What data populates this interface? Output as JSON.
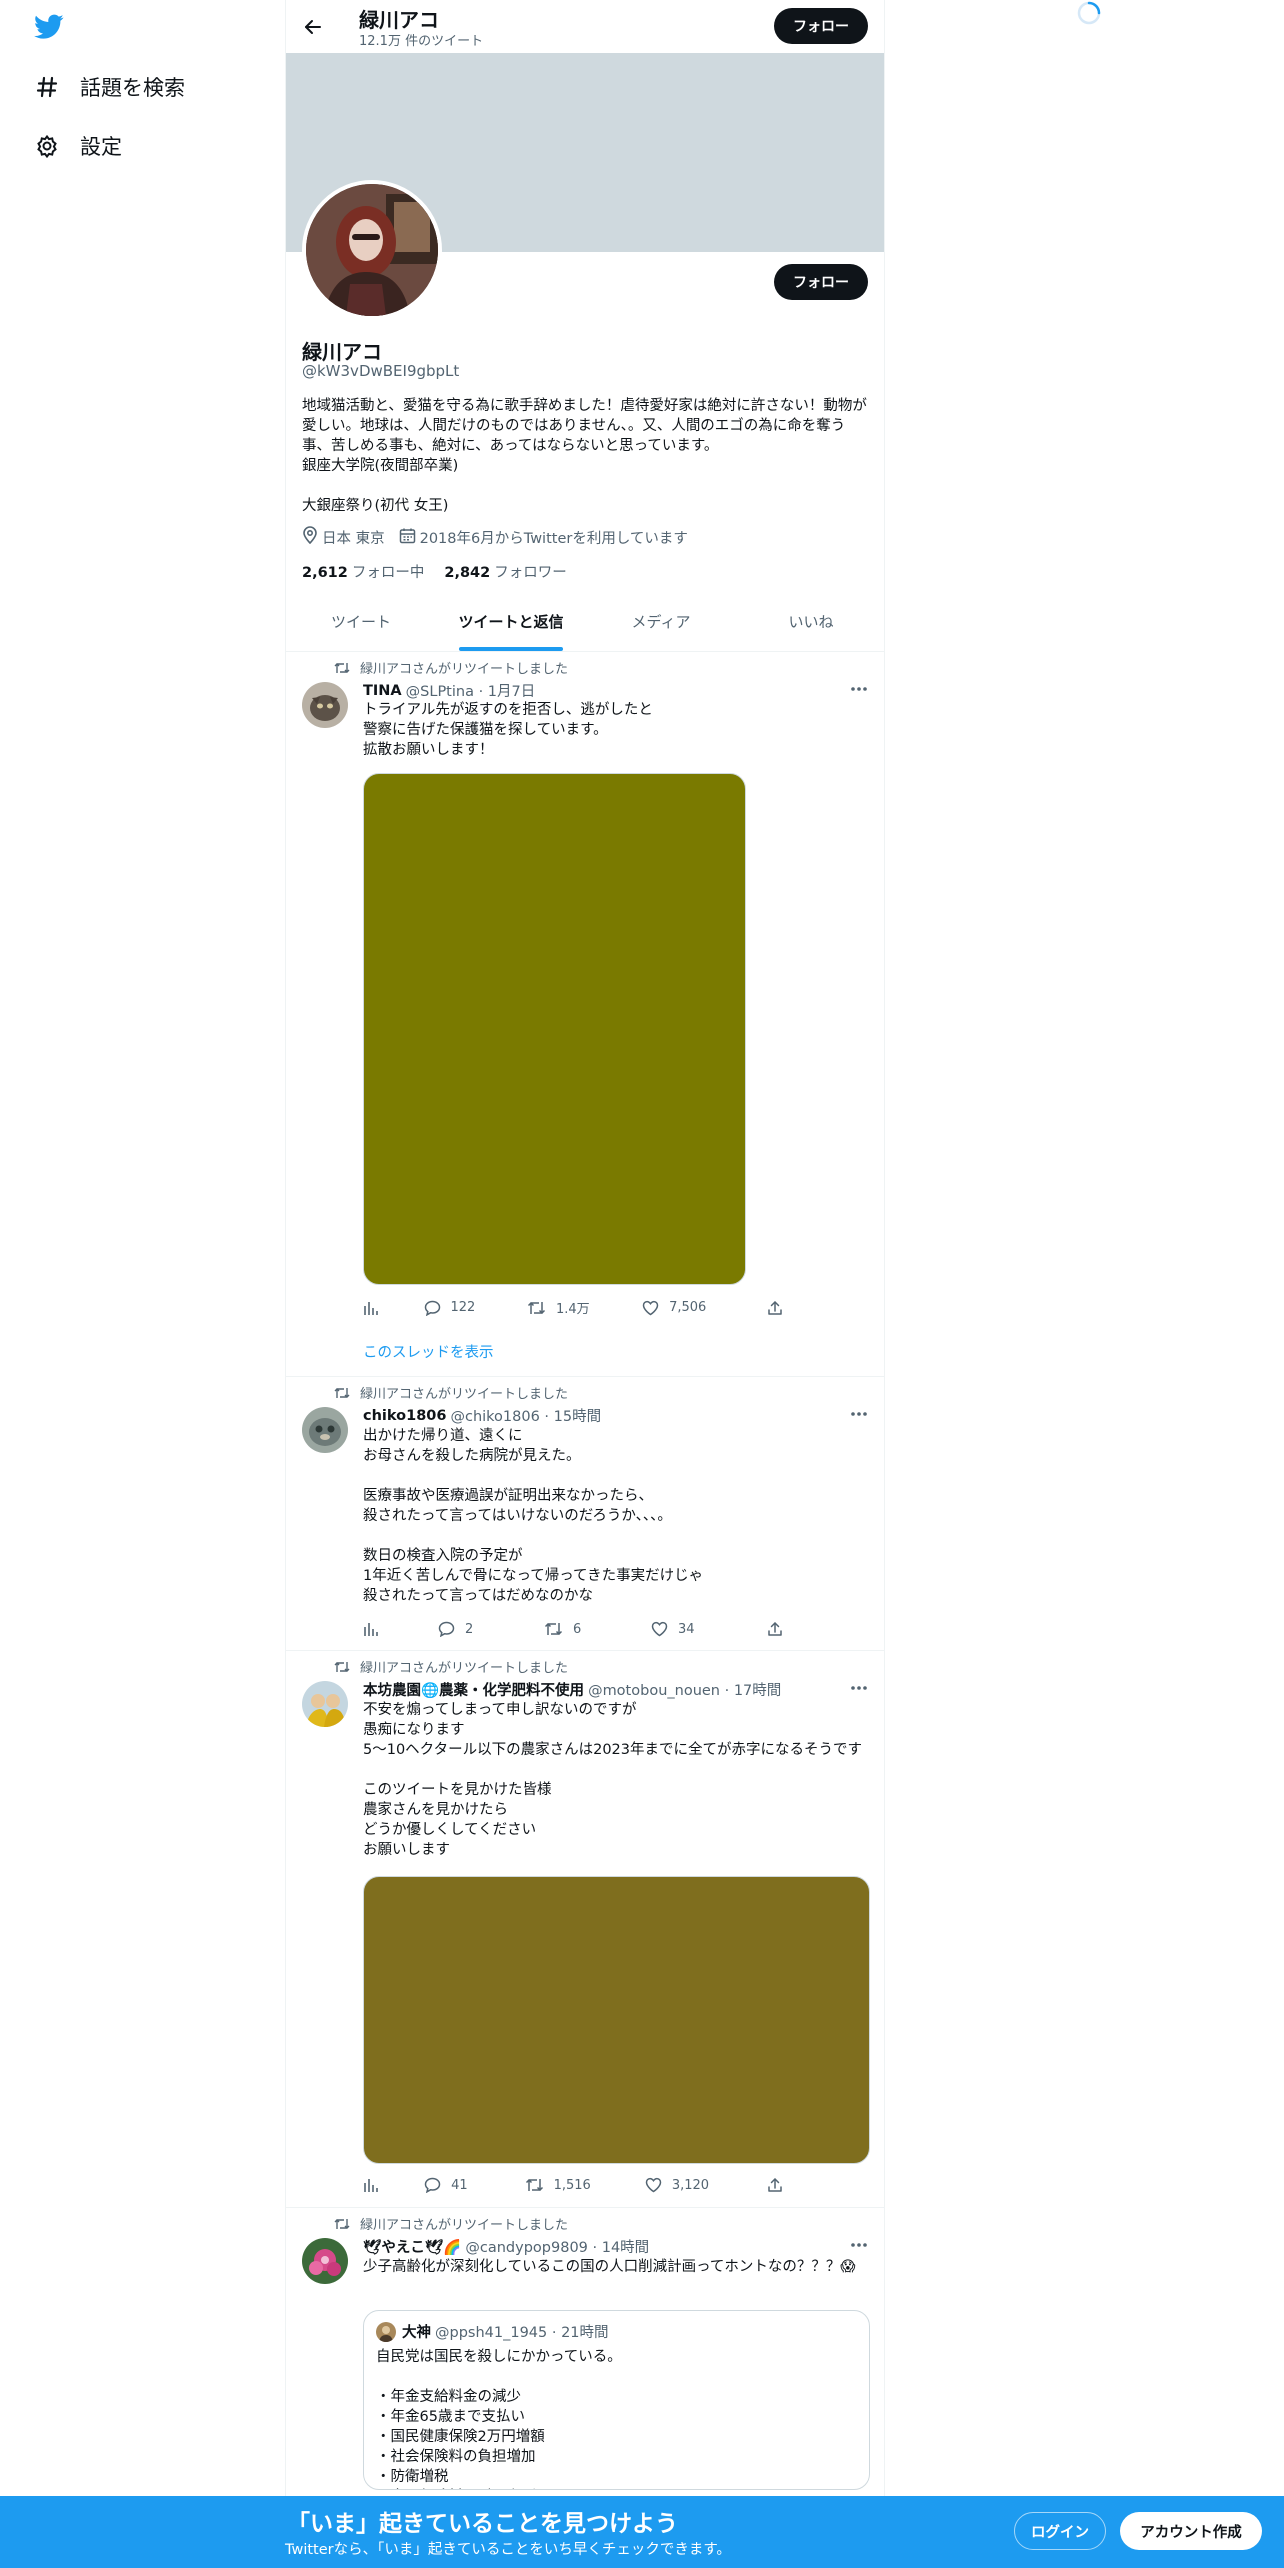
{
  "colors": {
    "accent": "#1d9bf0",
    "text": "#0f1419",
    "muted": "#536471",
    "banner": "#cfd9de",
    "media1": "#7a7a00",
    "media2": "#7f6e1e"
  },
  "nav": {
    "logo_icon": "twitter-bird-icon",
    "items": [
      {
        "icon": "hashtag-icon",
        "label": "話題を検索"
      },
      {
        "icon": "gear-icon",
        "label": "設定"
      }
    ]
  },
  "header": {
    "name": "緑川アコ",
    "tweet_count": "12.1万 件のツイート",
    "follow_label": "フォロー"
  },
  "profile": {
    "name": "緑川アコ",
    "handle": "@kW3vDwBEI9gbpLt",
    "follow_label": "フォロー",
    "bio": "地域猫活動と、愛猫を守る為に歌手辞めました！虐待愛好家は絶対に許さない！動物が愛しい。地球は、人間だけのものではありません、。又、人間のエゴの為に命を奪う事、苦しめる事も、絶対に、あってはならないと思っています。\n銀座大学院(夜間部卒業)\n\n大銀座祭り(初代 女王)",
    "location": "日本 東京",
    "joined": "2018年6月からTwitterを利用しています",
    "following_count": "2,612",
    "following_label": "フォロー中",
    "followers_count": "2,842",
    "followers_label": "フォロワー"
  },
  "tabs": [
    {
      "label": "ツイート",
      "active": false
    },
    {
      "label": "ツイートと返信",
      "active": true
    },
    {
      "label": "メディア",
      "active": false
    },
    {
      "label": "いいね",
      "active": false
    }
  ],
  "tweets": [
    {
      "retweet_label": "緑川アコさんがリツイートしました",
      "name": "TINA",
      "handle_time": "@SLPtina · 1月7日",
      "text": "トライアル先が返すのを拒否し、逃がしたと\n警察に告げた保護猫を探しています。\n拡散お願いします！",
      "replies": "122",
      "retweets": "1.4万",
      "likes": "7,506",
      "thread_link": "このスレッドを表示"
    },
    {
      "retweet_label": "緑川アコさんがリツイートしました",
      "name": "chiko1806",
      "handle_time": "@chiko1806 · 15時間",
      "text": "出かけた帰り道、遠くに\nお母さんを殺した病院が見えた。\n\n医療事故や医療過誤が証明出来なかったら、\n殺されたって言ってはいけないのだろうか、、、。\n\n数日の検査入院の予定が\n1年近く苦しんで骨になって帰ってきた事実だけじゃ\n殺されたって言ってはだめなのかな",
      "replies": "2",
      "retweets": "6",
      "likes": "34"
    },
    {
      "retweet_label": "緑川アコさんがリツイートしました",
      "name": "本坊農園🌐農薬・化学肥料不使用",
      "handle_time": "@motobou_nouen · 17時間",
      "text": "不安を煽ってしまって申し訳ないのですが\n愚痴になります\n5～10ヘクタール以下の農家さんは2023年までに全てが赤字になるそうです\n\nこのツイートを見かけた皆様\n農家さんを見かけたら\nどうか優しくしてください\nお願いします",
      "replies": "41",
      "retweets": "1,516",
      "likes": "3,120"
    },
    {
      "retweet_label": "緑川アコさんがリツイートしました",
      "name": "🕊やえこ🕊🌈",
      "handle_time": "@candypop9809 · 14時間",
      "text": "少子高齢化が深刻化しているこの国の人口削減計画ってホントなの？？？😱",
      "quote": {
        "name": "大神",
        "handle_time": "@ppsh41_1945 · 21時間",
        "text": "自民党は国民を殺しにかかっている。\n\n・年金支給料金の減少\n・年金65歳まで支払い\n・国民健康保険2万円増額\n・社会保険料の負担増加\n・防衛増税\n・雇用保険料の引き上げ"
      }
    }
  ],
  "bottom_bar": {
    "title": "「いま」起きていることを見つけよう",
    "subtitle": "Twitterなら、「いま」起きていることをいち早くチェックできます。",
    "login_label": "ログイン",
    "signup_label": "アカウント作成"
  }
}
